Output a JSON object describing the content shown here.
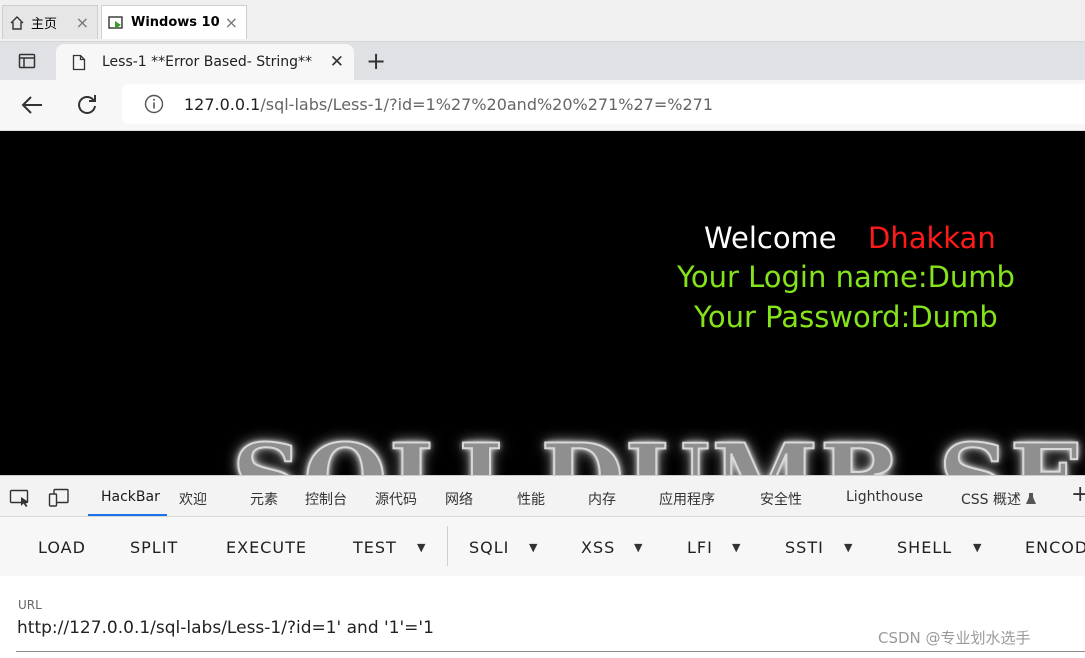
{
  "vm_tabs": [
    {
      "label": "主页"
    },
    {
      "label": "Windows 10"
    }
  ],
  "browser": {
    "tab_title": "Less-1 **Error Based- String**",
    "url_host": "127.0.0.1",
    "url_path": "/sql-labs/Less-1/?id=1%27%20and%20%271%27=%271"
  },
  "page": {
    "welcome": "Welcome",
    "name": "Dhakkan",
    "login_name": "Your Login name:Dumb",
    "password": "Your Password:Dumb",
    "banner": "SQLI DUMB SE"
  },
  "devtools_tabs": [
    "HackBar",
    "欢迎",
    "元素",
    "控制台",
    "源代码",
    "网络",
    "性能",
    "内存",
    "应用程序",
    "安全性",
    "Lighthouse",
    "CSS 概述"
  ],
  "hackbar": {
    "buttons": [
      "LOAD",
      "SPLIT",
      "EXECUTE",
      "TEST",
      "SQLI",
      "XSS",
      "LFI",
      "SSTI",
      "SHELL",
      "ENCOD"
    ],
    "url_label": "URL",
    "url_value": "http://127.0.0.1/sql-labs/Less-1/?id=1' and '1'='1"
  },
  "watermark": "CSDN @专业划水选手",
  "colors": {
    "welcome": "#ffffff",
    "name": "#ff1a1a",
    "login": "#84e31a",
    "active_tab_underline": "#1a73e8"
  },
  "icons": [
    "home-icon",
    "vm-screen-icon",
    "sidebar-icon",
    "document-icon",
    "back-arrow-icon",
    "refresh-icon",
    "info-icon",
    "inspect-icon",
    "device-icon",
    "flask-icon",
    "plus-icon"
  ]
}
